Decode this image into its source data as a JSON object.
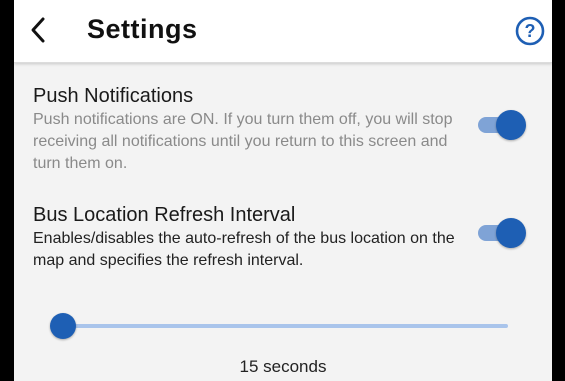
{
  "header": {
    "back_icon": "chevron-left-icon",
    "title": "Settings",
    "help_icon": "help-circle-icon"
  },
  "push_notifications": {
    "title": "Push Notifications",
    "description": "Push notifications are ON. If you turn them off, you will stop receiving all notifications until you return to this screen and turn them on.",
    "enabled": true
  },
  "bus_refresh": {
    "title": "Bus Location Refresh Interval",
    "description": "Enables/disables the auto-refresh of the bus location on the map and specifies the refresh interval.",
    "enabled": true,
    "slider_fraction": 0.0,
    "value_label": "15 seconds"
  },
  "colors": {
    "accent": "#1e5fb4",
    "track": "#7fa3d6",
    "rail": "#a9c4eb",
    "help": "#1e5fb4"
  }
}
